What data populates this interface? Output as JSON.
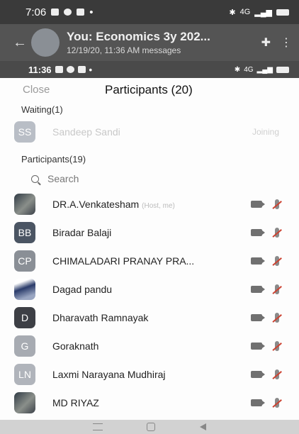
{
  "outer_status": {
    "time": "7:06",
    "signal": "4G"
  },
  "chat": {
    "title": "You: Economics 3y 202...",
    "subtitle": "12/19/20, 11:36 AM  messages"
  },
  "inner_status": {
    "time": "11:36",
    "signal": "4G"
  },
  "participants_panel": {
    "close_label": "Close",
    "title": "Participants (20)",
    "waiting_label": "Waiting(1)",
    "waiting": [
      {
        "initials": "SS",
        "name": "Sandeep Sandi",
        "status": "Joining",
        "color": "#b9bec6"
      }
    ],
    "participants_label": "Participants(19)",
    "search_placeholder": "Search",
    "participants": [
      {
        "initials": "",
        "name": "DR.A.Venkatesham",
        "role": "(Host, me)",
        "avatar": "photo",
        "color": "#3b4149"
      },
      {
        "initials": "BB",
        "name": "Biradar Balaji",
        "role": "",
        "avatar": "initials",
        "color": "#4b5563"
      },
      {
        "initials": "CP",
        "name": "CHIMALADARI PRANAY PRA...",
        "role": "",
        "avatar": "initials",
        "color": "#8a8f96"
      },
      {
        "initials": "",
        "name": "Dagad pandu",
        "role": "",
        "avatar": "photo2",
        "color": "#2a3b6a"
      },
      {
        "initials": "D",
        "name": "Dharavath Ramnayak",
        "role": "",
        "avatar": "initials",
        "color": "#3d3f45"
      },
      {
        "initials": "G",
        "name": "Goraknath",
        "role": "",
        "avatar": "initials",
        "color": "#a7abb2"
      },
      {
        "initials": "LN",
        "name": "Laxmi Narayana Mudhiraj",
        "role": "",
        "avatar": "initials",
        "color": "#b0b4bb"
      },
      {
        "initials": "",
        "name": "MD RIYAZ",
        "role": "",
        "avatar": "photo",
        "color": "#777"
      }
    ]
  }
}
